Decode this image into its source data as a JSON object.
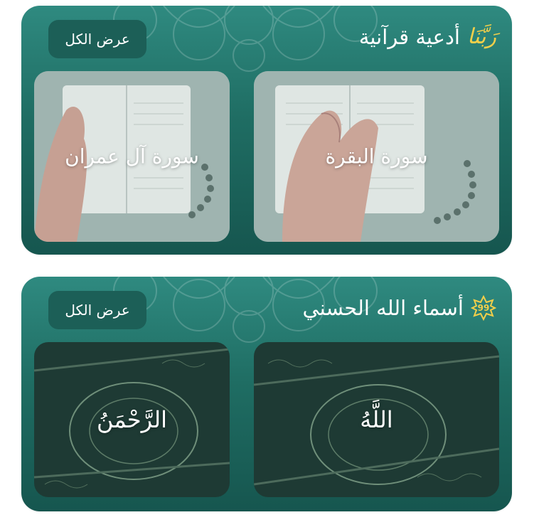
{
  "duas_section": {
    "title": "أدعية قرآنية",
    "title_word_art": "رَبَّنَا",
    "view_all_label": "عرض الكل",
    "cards": [
      {
        "label": "سورة البقرة"
      },
      {
        "label": "سورة آل عمران"
      }
    ]
  },
  "names_section": {
    "title": "أسماء الله الحسني",
    "badge_number": "99",
    "view_all_label": "عرض الكل",
    "cards": [
      {
        "label": "اللَّهُ"
      },
      {
        "label": "الرَّحْمَنُ"
      }
    ]
  },
  "colors": {
    "section_bg": "#1f6d63",
    "accent_gold": "#f2cf4a",
    "button_bg": "#1c5f57"
  }
}
